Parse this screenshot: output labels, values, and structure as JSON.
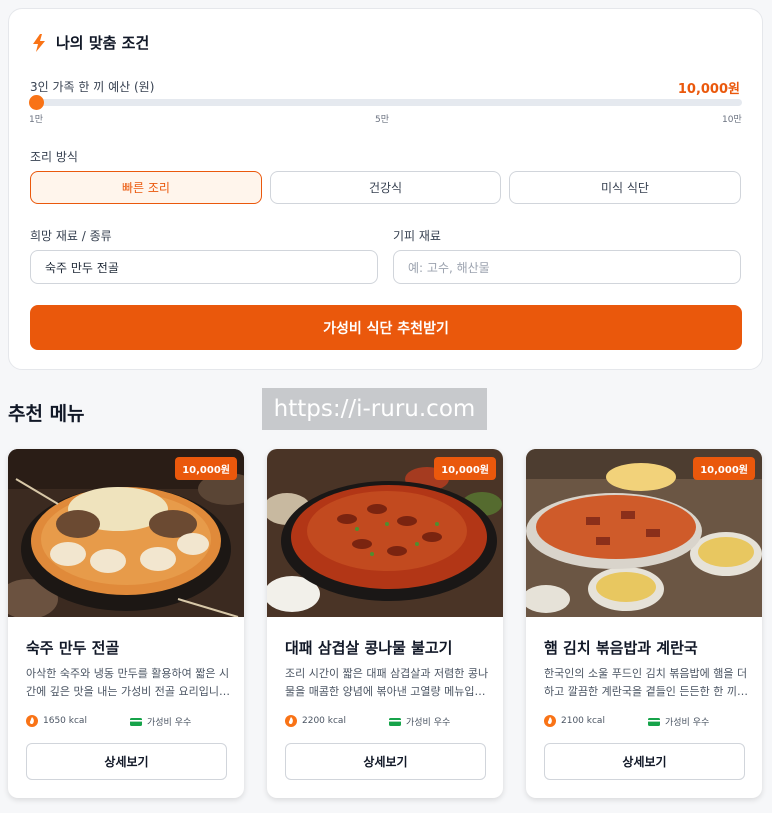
{
  "panel": {
    "title": "나의 맞춤 조건",
    "icon": "lightning-icon",
    "accent": "#ea580c",
    "budget": {
      "label": "3인 가족 한 끼 예산 (원)",
      "value_text": "10,000원",
      "fraction": 0.0,
      "ticks": [
        "1만",
        "5만",
        "10만"
      ]
    },
    "cooking": {
      "label": "조리 방식",
      "options": [
        "빠른 조리",
        "건강식",
        "미식 식단"
      ],
      "selected": 0
    },
    "wish": {
      "label": "희망 재료 / 종류",
      "value": "숙주 만두 전골"
    },
    "avoid": {
      "label": "기피 재료",
      "placeholder": "예: 고수, 해산물"
    },
    "cta_label": "가성비 식단 추천받기"
  },
  "watermark": "https://i-ruru.com",
  "section_title": "추천 메뉴",
  "cards": [
    {
      "price": "10,000원",
      "title": "숙주 만두 전골",
      "desc": "아삭한 숙주와 냉동 만두를 활용하여 짧은 시간에 깊은 맛을 내는 가성비 전골 요리입니다.",
      "kcal": "1650 kcal",
      "tag": "가성비 우수",
      "button": "상세보기"
    },
    {
      "price": "10,000원",
      "title": "대패 삼겹살 콩나물 불고기",
      "desc": "조리 시간이 짧은 대패 삼겹살과 저렴한 콩나물을 매콤한 양념에 볶아낸 고열량 메뉴입니다.",
      "kcal": "2200 kcal",
      "tag": "가성비 우수",
      "button": "상세보기"
    },
    {
      "price": "10,000원",
      "title": "햄 김치 볶음밥과 계란국",
      "desc": "한국인의 소울 푸드인 김치 볶음밥에 햄을 더하고 깔끔한 계란국을 곁들인 든든한 한 끼입니다.",
      "kcal": "2100 kcal",
      "tag": "가성비 우수",
      "button": "상세보기"
    }
  ]
}
